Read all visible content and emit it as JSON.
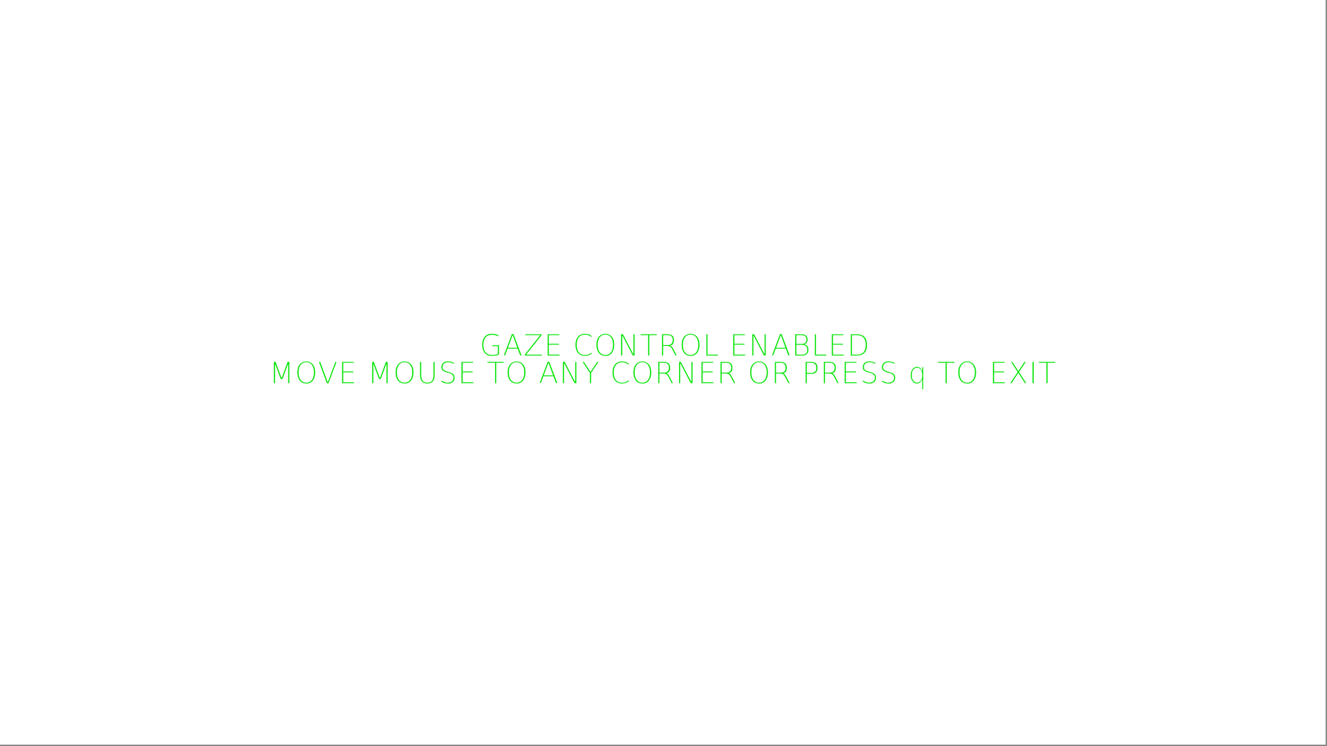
{
  "overlay": {
    "status_text": "GAZE CONTROL ENABLED",
    "instruction_text": "MOVE MOUSE TO ANY CORNER OR PRESS q TO EXIT",
    "text_color": "#00e400",
    "background_color": "#ffffff"
  }
}
